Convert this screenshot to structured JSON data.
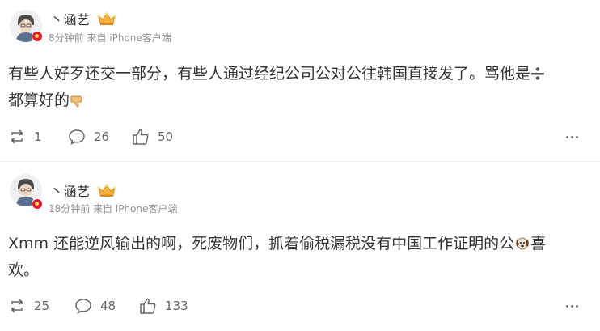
{
  "posts": [
    {
      "username": "丶涵艺",
      "meta": "8分钟前 来自 iPhone客户端",
      "content_line1": "有些人好歹还交一部分，有些人通过经纪公司公对公往韩国直接发了。骂他是",
      "content_line2": "都算好的",
      "emojis": [
        "divide-emoji",
        "thumbs-down-emoji"
      ],
      "repost_count": "1",
      "comment_count": "26",
      "like_count": "50"
    },
    {
      "username": "丶涵艺",
      "meta": "18分钟前 来自 iPhone客户端",
      "content_line1": "Xmm 还能逆风输出的啊，死废物们，抓着偷税漏税没有中国工作证明的公",
      "content_line1_tail": "喜",
      "content_line2": "欢。",
      "emojis": [
        "dog-face-emoji"
      ],
      "repost_count": "25",
      "comment_count": "48",
      "like_count": "133"
    }
  ],
  "colors": {
    "text": "#333333",
    "meta": "#939393",
    "badge": "#e6162d",
    "crown": "#f6b23c"
  }
}
